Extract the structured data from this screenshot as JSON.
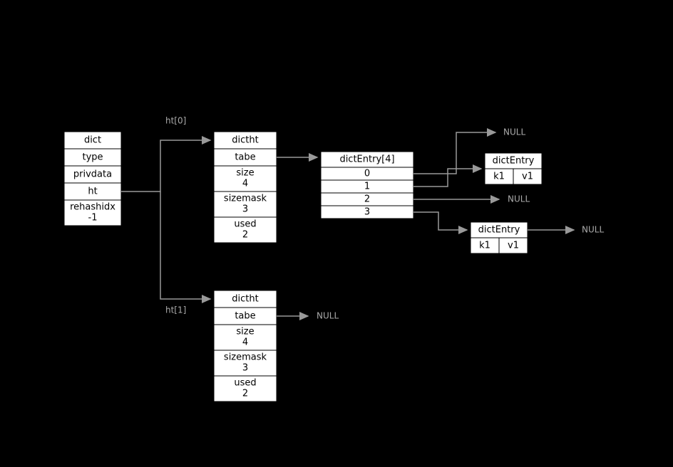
{
  "dict": {
    "title": "dict",
    "fields": [
      "type",
      "privdata",
      "ht"
    ],
    "rehash_label": "rehashidx",
    "rehash_value": "-1"
  },
  "ht_labels": {
    "ht0": "ht[0]",
    "ht1": "ht[1]"
  },
  "dictht0": {
    "title": "dictht",
    "tabe": "tabe",
    "size_label": "size",
    "size_value": "4",
    "sizemask_label": "sizemask",
    "sizemask_value": "3",
    "used_label": "used",
    "used_value": "2"
  },
  "dictht1": {
    "title": "dictht",
    "tabe": "tabe",
    "size_label": "size",
    "size_value": "4",
    "sizemask_label": "sizemask",
    "sizemask_value": "3",
    "used_label": "used",
    "used_value": "2"
  },
  "dictEntryArr": {
    "title": "dictEntry[4]",
    "indices": [
      "0",
      "1",
      "2",
      "3"
    ]
  },
  "entry1": {
    "title": "dictEntry",
    "k": "k1",
    "v": "v1"
  },
  "entry2": {
    "title": "dictEntry",
    "k": "k1",
    "v": "v1"
  },
  "null_label": "NULL"
}
